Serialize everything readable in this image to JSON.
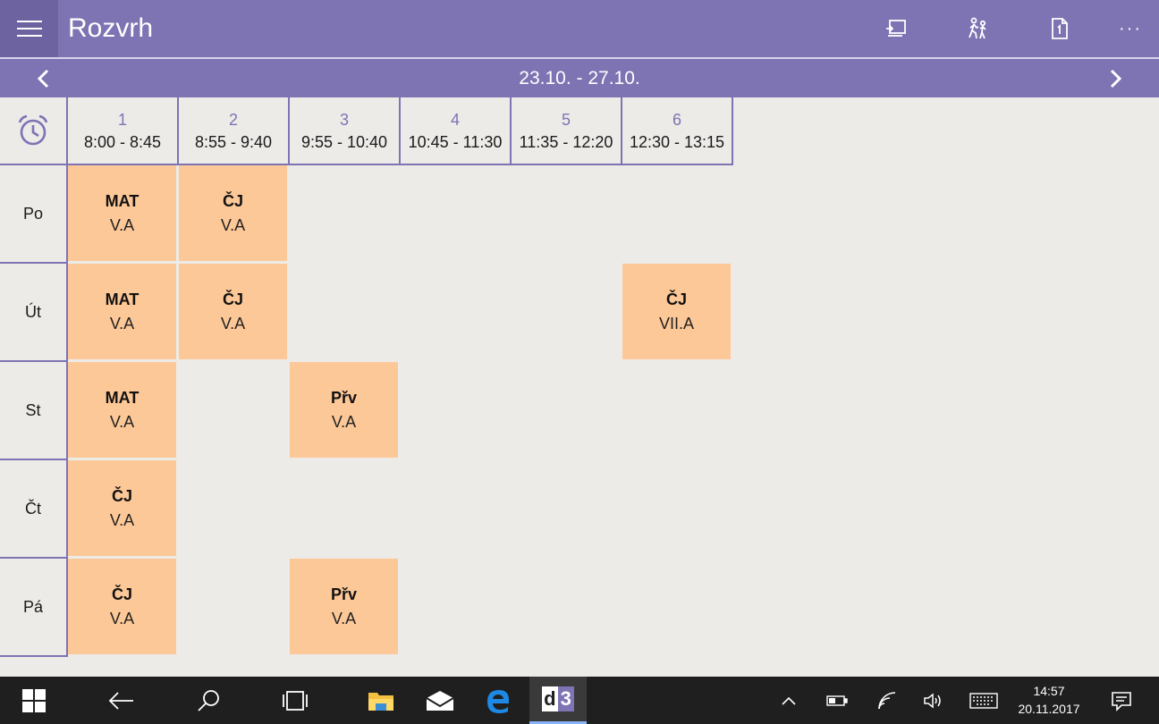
{
  "app": {
    "title": "Rozvrh"
  },
  "header": {
    "menu_icon": "hamburger-icon",
    "actions": [
      {
        "name": "substitutions-icon"
      },
      {
        "name": "people-walking-icon"
      },
      {
        "name": "document-icon"
      },
      {
        "name": "more-icon",
        "label": "···"
      }
    ]
  },
  "week": {
    "label": "23.10. - 27.10.",
    "prev_icon": "chevron-left-icon",
    "next_icon": "chevron-right-icon"
  },
  "periods": [
    {
      "num": "1",
      "time": "8:00 - 8:45"
    },
    {
      "num": "2",
      "time": "8:55 - 9:40"
    },
    {
      "num": "3",
      "time": "9:55 - 10:40"
    },
    {
      "num": "4",
      "time": "10:45 - 11:30"
    },
    {
      "num": "5",
      "time": "11:35 - 12:20"
    },
    {
      "num": "6",
      "time": "12:30 - 13:15"
    }
  ],
  "days": [
    "Po",
    "Út",
    "St",
    "Čt",
    "Pá"
  ],
  "lessons": [
    {
      "day": 0,
      "period": 0,
      "subject": "MAT",
      "class": "V.A"
    },
    {
      "day": 0,
      "period": 1,
      "subject": "ČJ",
      "class": "V.A"
    },
    {
      "day": 1,
      "period": 0,
      "subject": "MAT",
      "class": "V.A"
    },
    {
      "day": 1,
      "period": 1,
      "subject": "ČJ",
      "class": "V.A"
    },
    {
      "day": 1,
      "period": 5,
      "subject": "ČJ",
      "class": "VII.A"
    },
    {
      "day": 2,
      "period": 0,
      "subject": "MAT",
      "class": "V.A"
    },
    {
      "day": 2,
      "period": 2,
      "subject": "Přv",
      "class": "V.A"
    },
    {
      "day": 3,
      "period": 0,
      "subject": "ČJ",
      "class": "V.A"
    },
    {
      "day": 4,
      "period": 0,
      "subject": "ČJ",
      "class": "V.A"
    },
    {
      "day": 4,
      "period": 2,
      "subject": "Přv",
      "class": "V.A"
    }
  ],
  "taskbar": {
    "time": "14:57",
    "date": "20.11.2017",
    "app_label": "d3"
  },
  "colors": {
    "accent": "#7e73b3",
    "lesson": "#fdc897",
    "background": "#ecebe8",
    "taskbar": "#1f1f1f"
  }
}
